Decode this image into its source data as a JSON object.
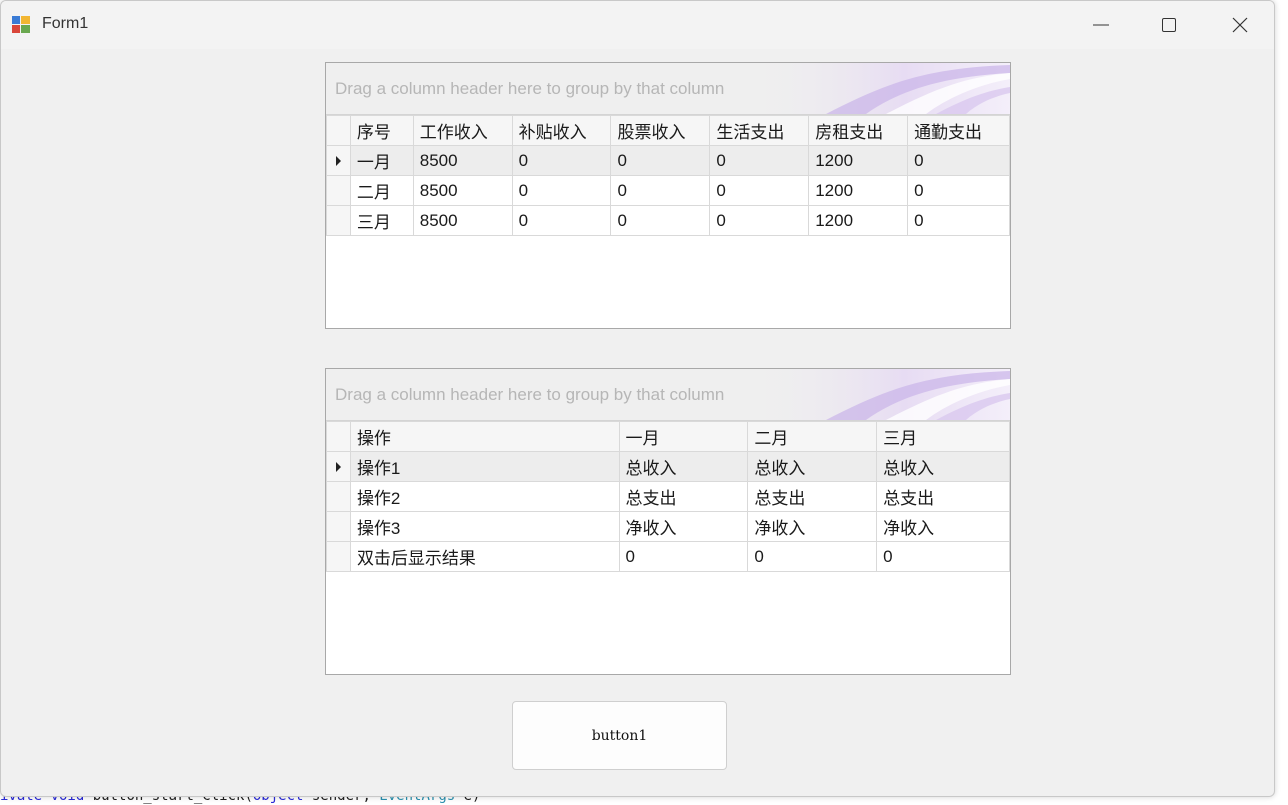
{
  "window": {
    "title": "Form1"
  },
  "code_line": {
    "kw": "ivate void",
    "mid": " button_start_Click(",
    "obj": "object",
    "sender": " sender, ",
    "ty": "EventArgs",
    "tail": " e)"
  },
  "grid1": {
    "group_hint": "Drag a column header here to group by that column",
    "columns": [
      "序号",
      "工作收入",
      "补贴收入",
      "股票收入",
      "生活支出",
      "房租支出",
      "通勤支出"
    ],
    "rows": [
      [
        "一月",
        "8500",
        "0",
        "0",
        "0",
        "1200",
        "0"
      ],
      [
        "二月",
        "8500",
        "0",
        "0",
        "0",
        "1200",
        "0"
      ],
      [
        "三月",
        "8500",
        "0",
        "0",
        "0",
        "1200",
        "0"
      ]
    ]
  },
  "grid2": {
    "group_hint": "Drag a column header here to group by that column",
    "columns": [
      "操作",
      "一月",
      "二月",
      "三月"
    ],
    "rows": [
      [
        "操作1",
        "总收入",
        "总收入",
        "总收入"
      ],
      [
        "操作2",
        "总支出",
        "总支出",
        "总支出"
      ],
      [
        "操作3",
        "净收入",
        "净收入",
        "净收入"
      ],
      [
        "双击后显示结果",
        "0",
        "0",
        "0"
      ]
    ]
  },
  "button1": {
    "label": "button1"
  },
  "icons": {
    "app": "form-app-icon",
    "minimize": "minimize-icon",
    "maximize": "maximize-icon",
    "close": "close-icon",
    "row_indicator": "row-indicator-arrow-icon"
  }
}
